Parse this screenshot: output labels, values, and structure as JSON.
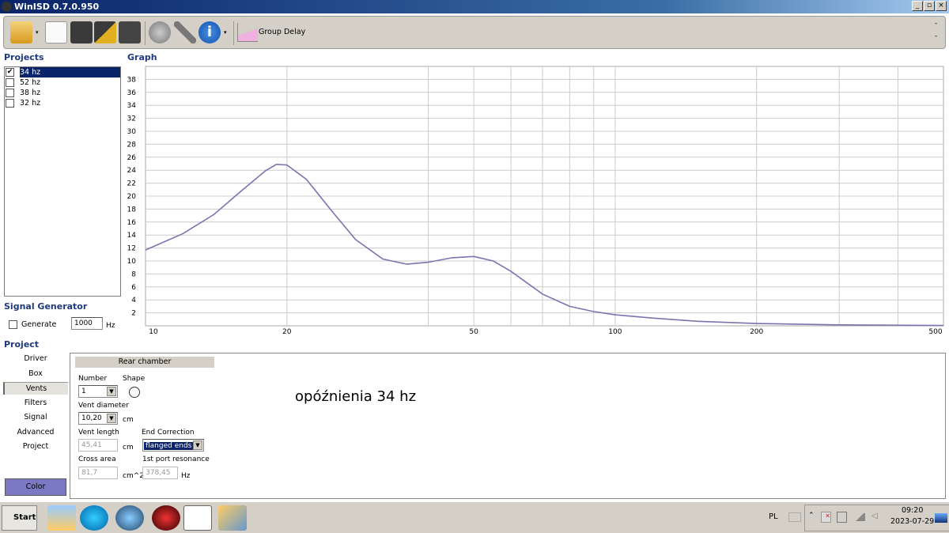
{
  "window": {
    "title": "WinISD 0.7.0.950",
    "min": "_",
    "max": "▫",
    "close": "×"
  },
  "toolbar": {
    "group_delay_label": "Group Delay",
    "right_dash1": "-",
    "right_dash2": "-"
  },
  "projects": {
    "heading": "Projects",
    "items": [
      {
        "label": "34 hz",
        "checked": true,
        "selected": true
      },
      {
        "label": "52 hz",
        "checked": false
      },
      {
        "label": "38 hz",
        "checked": false
      },
      {
        "label": "32 hz",
        "checked": false
      }
    ]
  },
  "graph_heading": "Graph",
  "chart_data": {
    "type": "line",
    "title": "Group Delay",
    "xscale": "log",
    "xlim": [
      10,
      500
    ],
    "ylim": [
      0,
      40
    ],
    "xticks": [
      10,
      20,
      50,
      100,
      200,
      500
    ],
    "xgrid": [
      20,
      40,
      50,
      60,
      70,
      80,
      90,
      100,
      200,
      300,
      400
    ],
    "yticks": [
      2,
      4,
      6,
      8,
      10,
      12,
      14,
      16,
      18,
      20,
      22,
      24,
      26,
      28,
      30,
      32,
      34,
      36,
      38
    ],
    "series": [
      {
        "name": "34 hz",
        "color": "#7a74b0",
        "x": [
          10,
          12,
          14,
          16,
          18,
          19,
          20,
          22,
          25,
          28,
          32,
          36,
          40,
          45,
          50,
          55,
          60,
          70,
          80,
          90,
          100,
          120,
          150,
          200,
          300,
          500
        ],
        "y": [
          11.7,
          14.2,
          17.2,
          20.8,
          23.9,
          24.9,
          24.8,
          22.6,
          17.6,
          13.3,
          10.3,
          9.5,
          9.8,
          10.5,
          10.7,
          10.0,
          8.4,
          4.9,
          3.0,
          2.2,
          1.7,
          1.2,
          0.7,
          0.35,
          0.15,
          0.05
        ]
      }
    ]
  },
  "signal": {
    "heading": "Signal Generator",
    "generate_label": "Generate",
    "generate_checked": false,
    "freq_value": "1000",
    "freq_unit": "Hz"
  },
  "project": {
    "heading": "Project",
    "nav": [
      "Driver",
      "Box",
      "Vents",
      "Filters",
      "Signal",
      "Advanced",
      "Project"
    ],
    "selected_nav": "Vents",
    "color_button": "Color"
  },
  "vents": {
    "section": "Rear chamber",
    "number_label": "Number",
    "number_value": "1",
    "shape_label": "Shape",
    "diameter_label": "Vent diameter",
    "diameter_value": "10,20",
    "diameter_unit": "cm",
    "length_label": "Vent length",
    "length_value": "45,41",
    "length_unit": "cm",
    "endcorr_label": "End Correction",
    "endcorr_value": "flanged ends",
    "area_label": "Cross area",
    "area_value": "81,7",
    "area_unit": "cm^2",
    "resonance_label": "1st port resonance",
    "resonance_value": "378,45",
    "resonance_unit": "Hz"
  },
  "annotation": "opóźnienia 34 hz",
  "taskbar": {
    "start": "Start",
    "lang": "PL",
    "time": "09:20",
    "date": "2023-07-29"
  },
  "colors": {
    "accent": "#0a246a",
    "curve": "#7a74b0",
    "color_button": "#7b78c4"
  }
}
